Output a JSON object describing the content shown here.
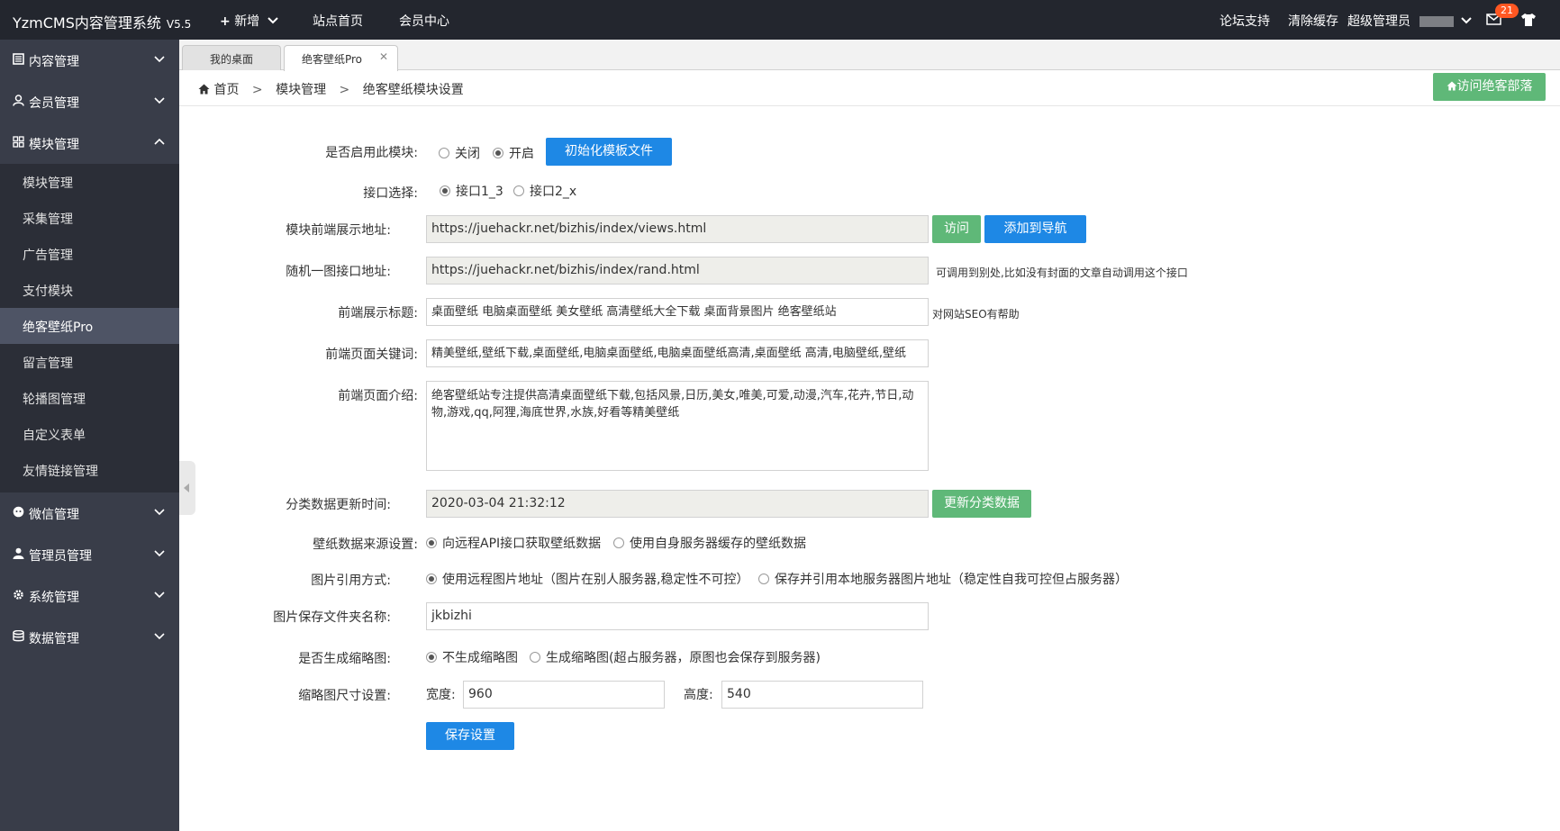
{
  "header": {
    "brand": "YzmCMS内容管理系统",
    "version": "V5.5",
    "nav": [
      "新增",
      "站点首页",
      "会员中心"
    ],
    "right": {
      "forum": "论坛支持",
      "clear_cache": "清除缓存",
      "admin": "超级管理员",
      "badge": "21"
    }
  },
  "sidebar": {
    "groups": [
      {
        "label": "内容管理",
        "icon": "document-icon"
      },
      {
        "label": "会员管理",
        "icon": "user-icon"
      },
      {
        "label": "模块管理",
        "icon": "grid-icon"
      },
      {
        "label": "微信管理",
        "icon": "wechat-icon"
      },
      {
        "label": "管理员管理",
        "icon": "admin-icon"
      },
      {
        "label": "系统管理",
        "icon": "gear-icon"
      },
      {
        "label": "数据管理",
        "icon": "database-icon"
      }
    ],
    "sub_items": [
      "模块管理",
      "采集管理",
      "广告管理",
      "支付模块",
      "绝客壁纸Pro",
      "留言管理",
      "轮播图管理",
      "自定义表单",
      "友情链接管理"
    ]
  },
  "tabs": [
    "我的桌面",
    "绝客壁纸Pro"
  ],
  "breadcrumb": {
    "home": "首页",
    "level1": "模块管理",
    "level2": "绝客壁纸模块设置",
    "sep": ">"
  },
  "visit_button": "访问绝客部落",
  "form": {
    "enable": {
      "label": "是否启用此模块:",
      "opt_off": "关闭",
      "opt_on": "开启",
      "init_button": "初始化模板文件"
    },
    "api": {
      "label": "接口选择:",
      "opt1": "接口1_3",
      "opt2": "接口2_x"
    },
    "front_url": {
      "label": "模块前端展示地址:",
      "value": "https://juehackr.net/bizhis/index/views.html",
      "visit_button": "访问",
      "add_nav_button": "添加到导航"
    },
    "rand_url": {
      "label": "随机一图接口地址:",
      "value": "https://juehackr.net/bizhis/index/rand.html",
      "hint": "可调用到别处,比如没有封面的文章自动调用这个接口"
    },
    "title": {
      "label": "前端展示标题:",
      "value": "桌面壁纸 电脑桌面壁纸 美女壁纸 高清壁纸大全下载 桌面背景图片 绝客壁纸站",
      "hint": "对网站SEO有帮助"
    },
    "keywords": {
      "label": "前端页面关键词:",
      "value": "精美壁纸,壁纸下载,桌面壁纸,电脑桌面壁纸,电脑桌面壁纸高清,桌面壁纸 高清,电脑壁纸,壁纸"
    },
    "description": {
      "label": "前端页面介绍:",
      "value": "绝客壁纸站专注提供高清桌面壁纸下载,包括风景,日历,美女,唯美,可爱,动漫,汽车,花卉,节日,动物,游戏,qq,阿狸,海底世界,水族,好看等精美壁纸"
    },
    "update_time": {
      "label": "分类数据更新时间:",
      "value": "2020-03-04 21:32:12",
      "button": "更新分类数据"
    },
    "source": {
      "label": "壁纸数据来源设置:",
      "opt1": "向远程API接口获取壁纸数据",
      "opt2": "使用自身服务器缓存的壁纸数据"
    },
    "image_ref": {
      "label": "图片引用方式:",
      "opt1": "使用远程图片地址（图片在别人服务器,稳定性不可控）",
      "opt2": "保存并引用本地服务器图片地址（稳定性自我可控但占服务器）"
    },
    "folder": {
      "label": "图片保存文件夹名称:",
      "value": "jkbizhi"
    },
    "thumb": {
      "label": "是否生成缩略图:",
      "opt1": "不生成缩略图",
      "opt2": "生成缩略图(超占服务器，原图也会保存到服务器)"
    },
    "thumb_size": {
      "label": "缩略图尺寸设置:",
      "width_label": "宽度:",
      "width": "960",
      "height_label": "高度:",
      "height": "540"
    },
    "save_button": "保存设置"
  }
}
